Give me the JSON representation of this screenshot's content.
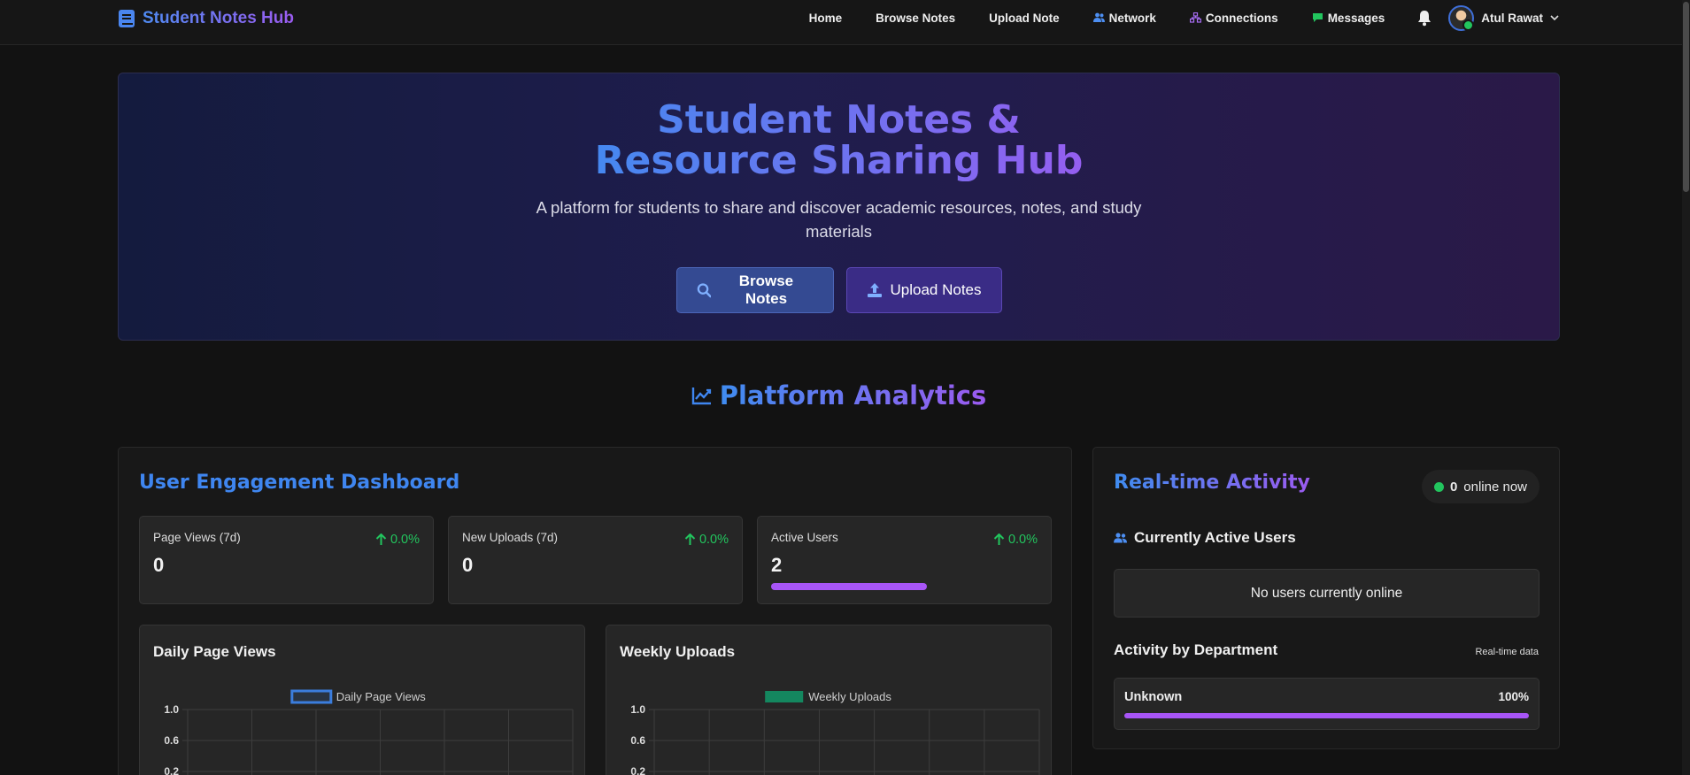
{
  "nav": {
    "brand": "Student Notes Hub",
    "links": [
      {
        "label": "Home",
        "icon": ""
      },
      {
        "label": "Browse Notes",
        "icon": ""
      },
      {
        "label": "Upload Note",
        "icon": ""
      },
      {
        "label": "Network",
        "icon": "users-icon"
      },
      {
        "label": "Connections",
        "icon": "sitemap-icon"
      },
      {
        "label": "Messages",
        "icon": "chat-icon"
      }
    ],
    "user_name": "Atul Rawat"
  },
  "hero": {
    "title": "Student Notes & Resource Sharing Hub",
    "subtitle": "A platform for students to share and discover academic resources, notes, and study materials",
    "browse_label": "Browse Notes",
    "upload_label": "Upload Notes"
  },
  "analytics": {
    "title": "Platform Analytics"
  },
  "dashboard": {
    "title": "User Engagement Dashboard",
    "stats": [
      {
        "label": "Page Views (7d)",
        "value": "0",
        "change": "0.0%"
      },
      {
        "label": "New Uploads (7d)",
        "value": "0",
        "change": "0.0%"
      },
      {
        "label": "Active Users",
        "value": "2",
        "change": "0.0%",
        "bar_fraction": 0.58
      }
    ]
  },
  "chart_data": [
    {
      "type": "line",
      "title": "Daily Page Views",
      "legend": [
        "Daily Page Views"
      ],
      "y_ticks": [
        "1.0",
        "0.6",
        "0.2"
      ],
      "ylim": [
        0,
        1.0
      ],
      "series": [
        {
          "name": "Daily Page Views",
          "values": [],
          "color": "#3b7ddd"
        }
      ],
      "grid": true,
      "legend_position": "top"
    },
    {
      "type": "bar",
      "title": "Weekly Uploads",
      "legend": [
        "Weekly Uploads"
      ],
      "y_ticks": [
        "1.0",
        "0.6",
        "0.2"
      ],
      "ylim": [
        0,
        1.0
      ],
      "series": [
        {
          "name": "Weekly Uploads",
          "values": [],
          "color": "#14875f"
        }
      ],
      "grid": true,
      "legend_position": "top"
    }
  ],
  "realtime": {
    "title": "Real-time Activity",
    "online_count": "0",
    "online_label": "online now",
    "active_users_heading": "Currently Active Users",
    "empty_text": "No users currently online",
    "dept_heading": "Activity by Department",
    "dept_note": "Real-time data",
    "departments": [
      {
        "name": "Unknown",
        "percent": "100%",
        "fraction": 1.0
      }
    ]
  },
  "colors": {
    "accent_blue": "#3f86f0",
    "accent_purple": "#9b5bf0",
    "success": "#22c55e",
    "bar": "#a855f7"
  }
}
